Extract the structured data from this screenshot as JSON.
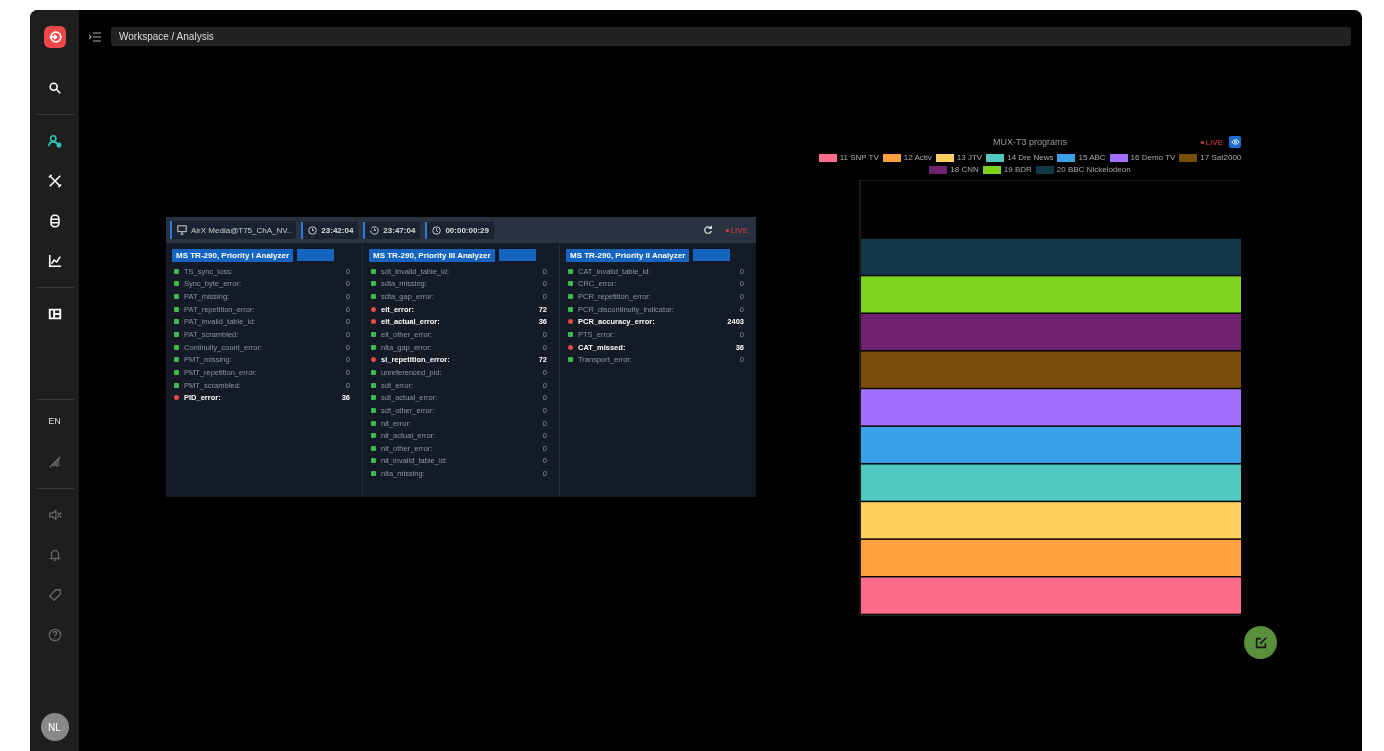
{
  "sidebar": {
    "top": [
      {
        "kind": "search",
        "selected": false
      },
      {
        "kind": "user-settings",
        "selected": true
      },
      {
        "kind": "tools",
        "selected": false
      },
      {
        "kind": "database",
        "selected": false
      },
      {
        "kind": "chart",
        "selected": false
      },
      {
        "kind": "layout",
        "selected": false
      }
    ],
    "language": "EN",
    "bottom": [
      {
        "kind": "signal-off",
        "selected": false
      },
      {
        "kind": "mute",
        "selected": false
      },
      {
        "kind": "bell",
        "selected": false
      },
      {
        "kind": "tag",
        "selected": false
      },
      {
        "kind": "help",
        "selected": false
      }
    ],
    "avatar": "NL"
  },
  "breadcrumb": "Workspace / Analysis",
  "analyzer": {
    "source": "AirX Media@T75_ChA_NV..",
    "start_time": "23:42:04",
    "end_time": "23:47:04",
    "duration": "00:00:00:29",
    "live": "LIVE",
    "columns": [
      {
        "title": "MS TR-290, Priority I Analyzer",
        "rows": [
          {
            "name": "TS_sync_loss:",
            "value": "0",
            "alarm": false
          },
          {
            "name": "Sync_byte_error:",
            "value": "0",
            "alarm": false
          },
          {
            "name": "PAT_missing:",
            "value": "0",
            "alarm": false
          },
          {
            "name": "PAT_repetition_error:",
            "value": "0",
            "alarm": false
          },
          {
            "name": "PAT_invalid_table_id:",
            "value": "0",
            "alarm": false
          },
          {
            "name": "PAT_scrambled:",
            "value": "0",
            "alarm": false
          },
          {
            "name": "Continuity_count_error:",
            "value": "0",
            "alarm": false
          },
          {
            "name": "PMT_missing:",
            "value": "0",
            "alarm": false
          },
          {
            "name": "PMT_repetition_error:",
            "value": "0",
            "alarm": false
          },
          {
            "name": "PMT_scrambled:",
            "value": "0",
            "alarm": false
          },
          {
            "name": "PID_error:",
            "value": "36",
            "alarm": true
          }
        ]
      },
      {
        "title": "MS TR-290, Priority III Analyzer",
        "rows": [
          {
            "name": "sdt_invalid_table_id:",
            "value": "0",
            "alarm": false
          },
          {
            "name": "sdta_missing:",
            "value": "0",
            "alarm": false
          },
          {
            "name": "sdta_gap_error:",
            "value": "0",
            "alarm": false
          },
          {
            "name": "eit_error:",
            "value": "72",
            "alarm": true
          },
          {
            "name": "eit_actual_error:",
            "value": "36",
            "alarm": true
          },
          {
            "name": "eit_other_error:",
            "value": "0",
            "alarm": false
          },
          {
            "name": "nita_gap_error:",
            "value": "0",
            "alarm": false
          },
          {
            "name": "si_repetition_error:",
            "value": "72",
            "alarm": true
          },
          {
            "name": "unreferenced_pid:",
            "value": "0",
            "alarm": false
          },
          {
            "name": "sdt_error:",
            "value": "0",
            "alarm": false
          },
          {
            "name": "sdt_actual_error:",
            "value": "0",
            "alarm": false
          },
          {
            "name": "sdt_other_error:",
            "value": "0",
            "alarm": false
          },
          {
            "name": "nit_error:",
            "value": "0",
            "alarm": false
          },
          {
            "name": "nit_actual_error:",
            "value": "0",
            "alarm": false
          },
          {
            "name": "nit_other_error:",
            "value": "0",
            "alarm": false
          },
          {
            "name": "nit_invalid_table_id:",
            "value": "0",
            "alarm": false
          },
          {
            "name": "nita_missing:",
            "value": "0",
            "alarm": false
          }
        ]
      },
      {
        "title": "MS TR-290, Priority II Analyzer",
        "rows": [
          {
            "name": "CAT_invalid_table_id:",
            "value": "0",
            "alarm": false
          },
          {
            "name": "CRC_error:",
            "value": "0",
            "alarm": false
          },
          {
            "name": "PCR_repetition_error:",
            "value": "0",
            "alarm": false
          },
          {
            "name": "PCR_discontinuity_indicator:",
            "value": "0",
            "alarm": false
          },
          {
            "name": "PCR_accuracy_error:",
            "value": "2403",
            "alarm": true
          },
          {
            "name": "PTS_error:",
            "value": "0",
            "alarm": false
          },
          {
            "name": "CAT_missed:",
            "value": "36",
            "alarm": true
          },
          {
            "name": "Transport_error:",
            "value": "0",
            "alarm": false
          }
        ]
      }
    ]
  },
  "chart": {
    "title": "MUX-T3 programs",
    "live": "LIVE",
    "legend": [
      {
        "label": "11 SNP TV",
        "color": "#ff6b8a"
      },
      {
        "label": "12 Activ",
        "color": "#ffa040"
      },
      {
        "label": "13 JTV",
        "color": "#ffd060"
      },
      {
        "label": "14 Dre News",
        "color": "#50c8c0"
      },
      {
        "label": "15 ABC",
        "color": "#3aa0e8"
      },
      {
        "label": "16 Demo TV",
        "color": "#a070ff"
      },
      {
        "label": "17 Sat2000",
        "color": "#7a4c0a"
      },
      {
        "label": "18 CNN",
        "color": "#6e2270"
      },
      {
        "label": "19 BDR",
        "color": "#7ed321"
      },
      {
        "label": "20 BBC Nickelodeon",
        "color": "#123848"
      }
    ]
  }
}
